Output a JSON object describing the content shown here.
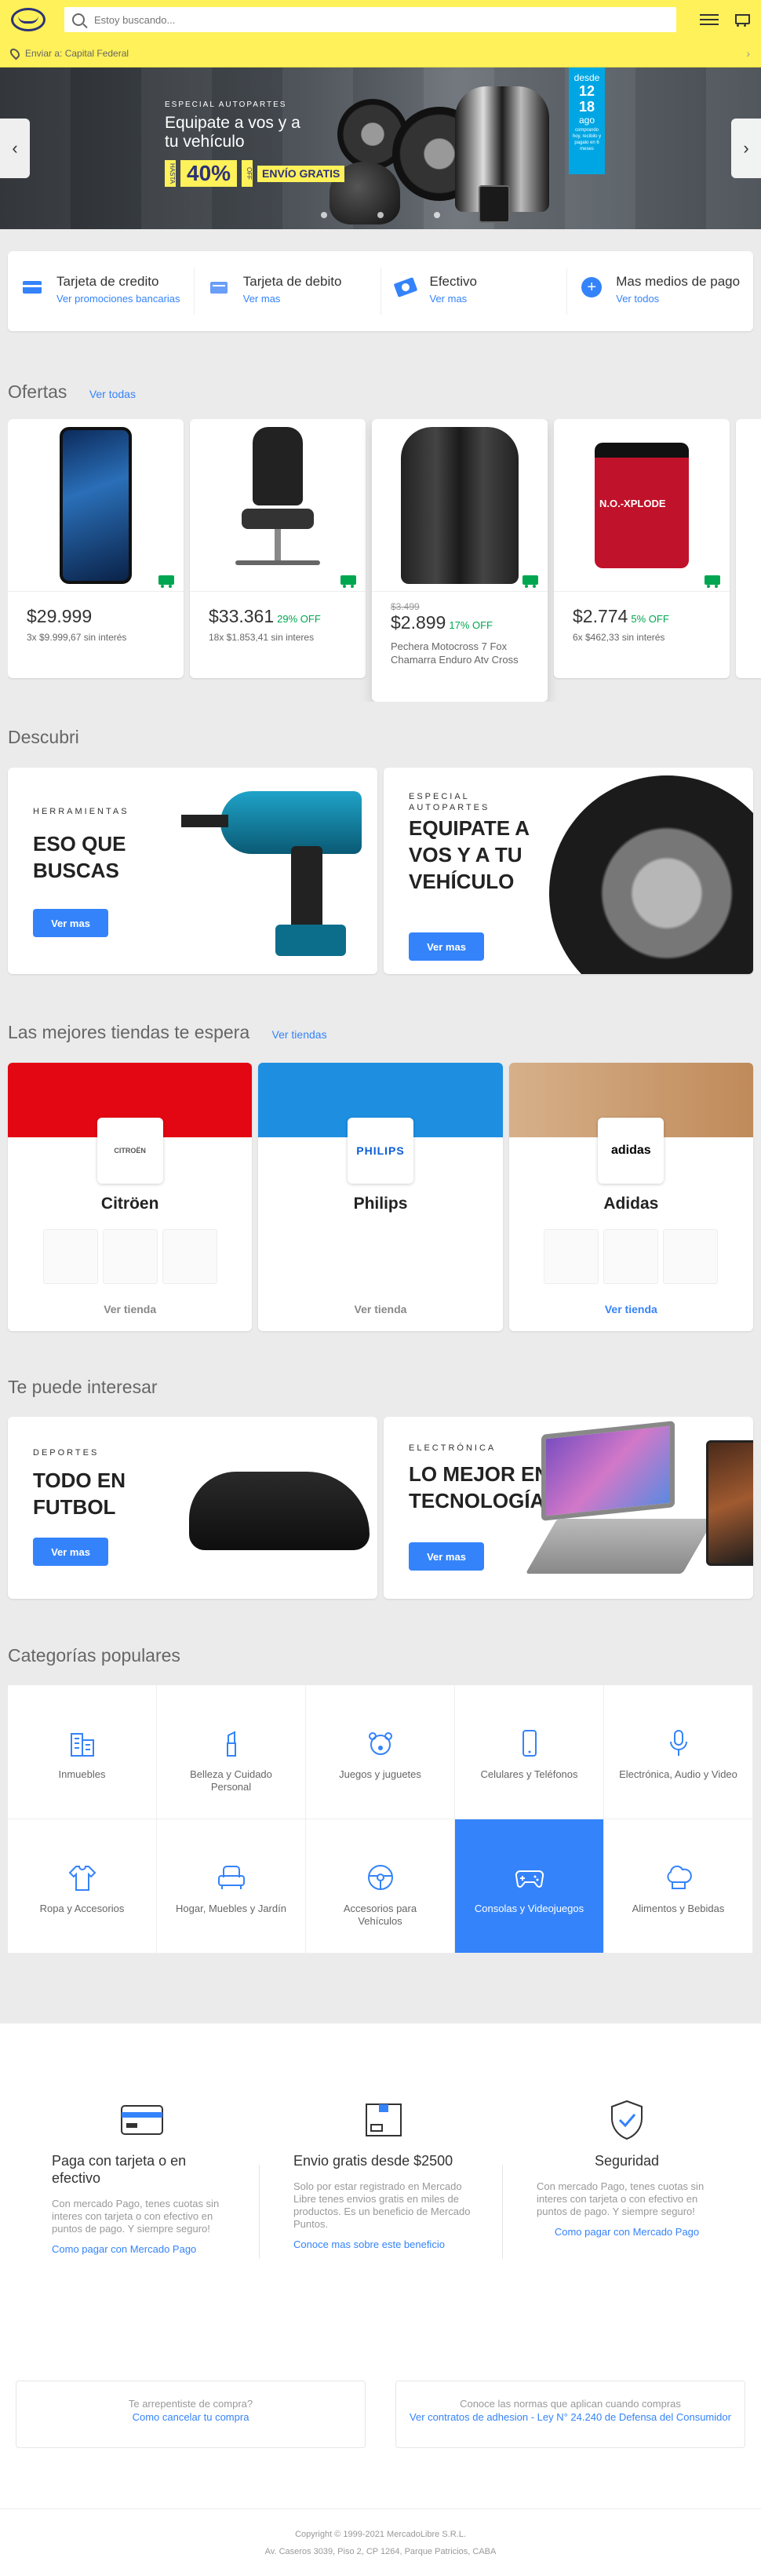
{
  "header": {
    "search_placeholder": "Estoy buscando...",
    "location_label": "Enviar a: Capital Federal"
  },
  "hero": {
    "kicker": "ESPECIAL AUTOPARTES",
    "title": "Equipate a vos y a tu vehículo",
    "discount_small": "HASTA",
    "discount": "40%",
    "discount_suffix": "OFF",
    "shipping": "ENVÍO GRATIS",
    "date_prefix": "desde",
    "date_day": "12",
    "date_day2": "18",
    "date_month": "ago",
    "date_note": "comprando hoy, recibilo y pagalo en 6 meses"
  },
  "payment": {
    "items": [
      {
        "title": "Tarjeta de credito",
        "link": "Ver promociones bancarias",
        "icon": "credit-card-icon"
      },
      {
        "title": "Tarjeta de debito",
        "link": "Ver mas",
        "icon": "debit-card-icon"
      },
      {
        "title": "Efectivo",
        "link": "Ver mas",
        "icon": "cash-icon"
      },
      {
        "title": "Mas medios de pago",
        "link": "Ver todos",
        "icon": "plus-icon"
      }
    ]
  },
  "offers": {
    "title": "Ofertas",
    "link": "Ver todas",
    "items": [
      {
        "price": "$29.999",
        "installments": "3x $9.999,67 sin interés",
        "off": "",
        "old": "",
        "title": ""
      },
      {
        "price": "$33.361",
        "off": "29% OFF",
        "installments": "18x $1.853,41 sin interes",
        "old": "",
        "title": ""
      },
      {
        "old": "$3.499",
        "price": "$2.899",
        "off": "17% OFF",
        "title": "Pechera Motocross 7 Fox Chamarra Enduro Atv Cross",
        "installments": ""
      },
      {
        "price": "$2.774",
        "off": "5% OFF",
        "installments": "6x $462,33 sin interés",
        "old": "",
        "title": ""
      }
    ]
  },
  "discover": {
    "title": "Descubri",
    "items": [
      {
        "kicker": "HERRAMIENTAS",
        "text": "ESO QUE BUSCAS",
        "button": "Ver mas"
      },
      {
        "kicker": "ESPECIAL AUTOPARTES",
        "text": "EQUIPATE A VOS Y A TU VEHÍCULO",
        "button": "Ver mas"
      }
    ]
  },
  "stores": {
    "title": "Las mejores tiendas te espera",
    "link": "Ver tiendas",
    "items": [
      {
        "name": "Citröen",
        "logo": "CITROËN",
        "link": "Ver tienda",
        "color": "#e30613"
      },
      {
        "name": "Philips",
        "logo": "PHILIPS",
        "link": "Ver tienda",
        "color": "#1e8fe0"
      },
      {
        "name": "Adidas",
        "logo": "adidas",
        "link": "Ver tienda",
        "color": "#c9a27c"
      }
    ]
  },
  "interest": {
    "title": "Te puede interesar",
    "items": [
      {
        "kicker": "DEPORTES",
        "text": "TODO EN FUTBOL",
        "button": "Ver mas"
      },
      {
        "kicker": "ELECTRÓNICA",
        "text": "LO MEJOR EN TECNOLOGÍA",
        "button": "Ver mas"
      }
    ]
  },
  "categories": {
    "title": "Categorías populares",
    "items": [
      {
        "name": "Inmuebles",
        "icon": "building-icon"
      },
      {
        "name": "Belleza y Cuidado Personal",
        "icon": "lipstick-icon"
      },
      {
        "name": "Juegos y juguetes",
        "icon": "teddy-bear-icon"
      },
      {
        "name": "Celulares y Teléfonos",
        "icon": "phone-icon"
      },
      {
        "name": "Electrónica, Audio y Video",
        "icon": "microphone-icon"
      },
      {
        "name": "Ropa y Accesorios",
        "icon": "shirt-icon"
      },
      {
        "name": "Hogar, Muebles y Jardín",
        "icon": "armchair-icon"
      },
      {
        "name": "Accesorios para Vehículos",
        "icon": "steering-wheel-icon"
      },
      {
        "name": "Consolas y Videojuegos",
        "icon": "gamepad-icon"
      },
      {
        "name": "Alimentos y Bebidas",
        "icon": "chef-hat-icon"
      }
    ]
  },
  "benefits": {
    "items": [
      {
        "title": "Paga con tarjeta o en efectivo",
        "text": "Con mercado Pago, tenes cuotas sin interes con tarjeta o con efectivo en puntos de pago. Y siempre seguro!",
        "link": "Como pagar con Mercado Pago"
      },
      {
        "title": "Envio gratis desde $2500",
        "text": "Solo por estar registrado en Mercado Libre tenes envios gratis en miles de productos. Es un beneficio de Mercado Puntos.",
        "link": "Conoce mas sobre este beneficio"
      },
      {
        "title": "Seguridad",
        "text": "Con mercado Pago, tenes cuotas sin interes con tarjeta o con efectivo en puntos de pago. Y siempre seguro!",
        "link": "Como pagar con Mercado Pago"
      }
    ]
  },
  "help": {
    "left_q": "Te arrepentiste de compra?",
    "left_link": "Como cancelar tu compra",
    "right_q": "Conoce las normas que aplican cuando compras",
    "right_link": "Ver contratos de adhesion - Ley N° 24.240 de Defensa del Consumidor"
  },
  "footer": {
    "copyright": "Copyright © 1999-2021 MercadoLibre S.R.L.",
    "address": "Av. Caseros 3039, Piso 2, CP 1264, Parque Patricios, CABA"
  },
  "colors": {
    "accent": "#3483fa",
    "brand_yellow": "#fff159",
    "offer_green": "#00a650"
  }
}
